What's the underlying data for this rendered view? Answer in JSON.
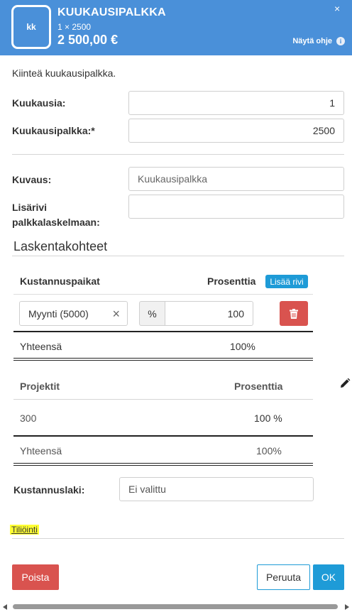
{
  "header": {
    "badge": "kk",
    "title": "KUUKAUSIPALKKA",
    "subtitle": "1 × 2500",
    "amount": "2 500,00 €",
    "help_label": "Näytä ohje",
    "help_icon": "i",
    "close_icon": "×",
    "color": "#4a90d9"
  },
  "description": "Kiinteä kuukausipalkka.",
  "fields": {
    "months_label": "Kuukausia:",
    "months_value": "1",
    "salary_label": "Kuukausipalkka:*",
    "salary_value": "2500",
    "desc_label": "Kuvaus:",
    "desc_placeholder": "Kuukausipalkka",
    "extra_label_1": "Lisärivi",
    "extra_label_2": "palkkalaskelmaan:",
    "extra_value": ""
  },
  "allocation": {
    "section_title": "Laskentakohteet",
    "cost_centers": {
      "col_name": "Kustannuspaikat",
      "col_pct": "Prosenttia",
      "add_label": "Lisää rivi",
      "row_value": "Myynti (5000)",
      "clear_icon": "×",
      "pct_addon": "%",
      "pct_value": "100",
      "total_label": "Yhteensä",
      "total_value": "100%"
    },
    "projects": {
      "col_name": "Projektit",
      "col_pct": "Prosenttia",
      "row_name": "300",
      "row_pct": "100 %",
      "total_label": "Yhteensä",
      "total_value": "100%"
    }
  },
  "cost_type": {
    "label": "Kustannuslaki:",
    "value": "Ei valittu"
  },
  "account_link": "Tiliöinti",
  "footer": {
    "delete_label": "Poista",
    "cancel_label": "Peruuta",
    "ok_label": "OK",
    "delete_color": "#d9534f",
    "ok_color": "#1e9bd7"
  }
}
